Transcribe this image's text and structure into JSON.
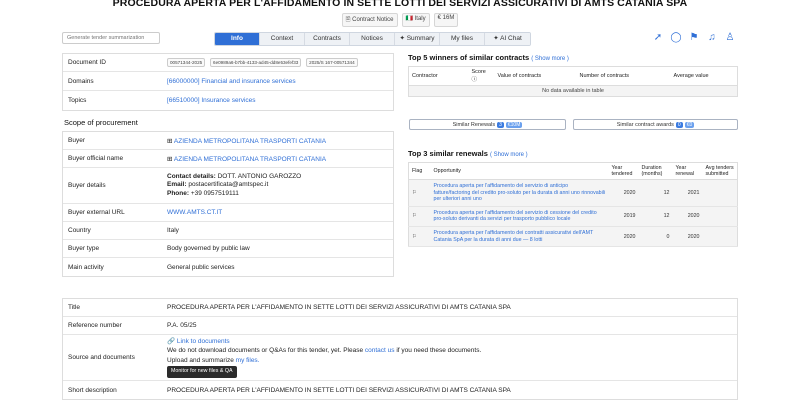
{
  "header": {
    "title": "PROCEDURA APERTA PER L'AFFIDAMENTO IN SETTE LOTTI DEI SERVIZI ASSICURATIVI DI AMTS CATANIA SPA",
    "badges": [
      "Contract Notice",
      "Italy",
      "€ 16M"
    ]
  },
  "search": {
    "placeholder": "Generate tender summarization"
  },
  "tabs": [
    {
      "label": "Info"
    },
    {
      "label": "Context"
    },
    {
      "label": "Contracts"
    },
    {
      "label": "Notices"
    },
    {
      "label": "Summary"
    },
    {
      "label": "My files"
    },
    {
      "label": "AI Chat"
    }
  ],
  "tab_icons": {
    "summary": "✦",
    "chat": "✦"
  },
  "toolbar_icons": [
    "share-icon",
    "comment-icon",
    "flag-icon",
    "bell-icon",
    "add-user-icon"
  ],
  "info": {
    "document_id_label": "Document ID",
    "document_ids": [
      "00571344-2025",
      "6e0989a6-b7bb-4133-ad45-dd8e53efef33",
      "2025/S 167-00571344"
    ],
    "domains_label": "Domains",
    "domains_value": "[66000000] Financial and insurance services",
    "topics_label": "Topics",
    "topics_value": "[66510000] Insurance services"
  },
  "scope": {
    "title": "Scope of procurement",
    "buyer_label": "Buyer",
    "buyer_value": "AZIENDA METROPOLITANA TRASPORTI CATANIA",
    "buyer_official_label": "Buyer official name",
    "buyer_official_value": "AZIENDA METROPOLITANA TRASPORTI CATANIA",
    "buyer_details_label": "Buyer details",
    "contact_label": "Contact details:",
    "contact_value": "DOTT. ANTONIO GAROZZO",
    "email_label": "Email:",
    "email_value": "postacertificata@amtspec.it",
    "phone_label": "Phone:",
    "phone_value": "+39 0957519111",
    "external_url_label": "Buyer external URL",
    "external_url_value": "WWW.AMTS.CT.IT",
    "country_label": "Country",
    "country_value": "Italy",
    "buyer_type_label": "Buyer type",
    "buyer_type_value": "Body governed by public law",
    "main_activity_label": "Main activity",
    "main_activity_value": "General public services"
  },
  "winners": {
    "title": "Top 5 winners of similar contracts",
    "show_more": "( Show more )",
    "columns": [
      "Contractor",
      "Score",
      "Value of contracts",
      "Number of contracts",
      "Average value"
    ],
    "empty": "No data available in table"
  },
  "similar": {
    "renewals_label": "Similar Renewals",
    "renewals_count": "3",
    "renewals_value": "€10M",
    "awards_label": "Similar contract awards",
    "awards_count": "0",
    "awards_value": "€0"
  },
  "renewals": {
    "title": "Top 3 similar renewals",
    "show_more": "( Show more )",
    "columns": [
      "Flag",
      "Opportunity",
      "Year tendered",
      "Duration (months)",
      "Year renewal",
      "Avg tenders submitted"
    ],
    "rows": [
      {
        "opportunity": "Procedura aperta per l'affidamento del servizio di anticipo fatture/factoring del credito pro-soluto per la durata di anni uno rinnovabili per ulteriori anni uno",
        "year": "2020",
        "duration": "12",
        "renewal": "2021",
        "avg": ""
      },
      {
        "opportunity": "Procedura aperta per l'affidamento del servizio di cessione del credito pro-soluto derivanti da servizi per trasporto pubblico locale",
        "year": "2019",
        "duration": "12",
        "renewal": "2020",
        "avg": ""
      },
      {
        "opportunity": "Procedura aperta per l'affidamento dei contratti assicurativi dell'AMT Catania SpA per la durata di anni due — 8 lotti",
        "year": "2020",
        "duration": "0",
        "renewal": "2020",
        "avg": ""
      }
    ]
  },
  "details": {
    "title_label": "Title",
    "title_value": "PROCEDURA APERTA PER L'AFFIDAMENTO IN SETTE LOTTI DEI SERVIZI ASSICURATIVI DI AMTS CATANIA SPA",
    "reference_label": "Reference number",
    "reference_value": "P.A. 05/25",
    "source_label": "Source and documents",
    "link_to_docs": "Link to documents",
    "nodl_pre": "We do not download documents or Q&As for this tender, yet. Please",
    "contact_us": "contact us",
    "nodl_post": "if you need these documents.",
    "upload_pre": "Upload and summarize",
    "my_files": "my files.",
    "monitor_button": "Monitor for new files & QA",
    "short_desc_label": "Short description",
    "short_desc_value": "PROCEDURA APERTA PER L'AFFIDAMENTO IN SETTE LOTTI DEI SERVIZI ASSICURATIVI DI AMTS CATANIA SPA"
  }
}
